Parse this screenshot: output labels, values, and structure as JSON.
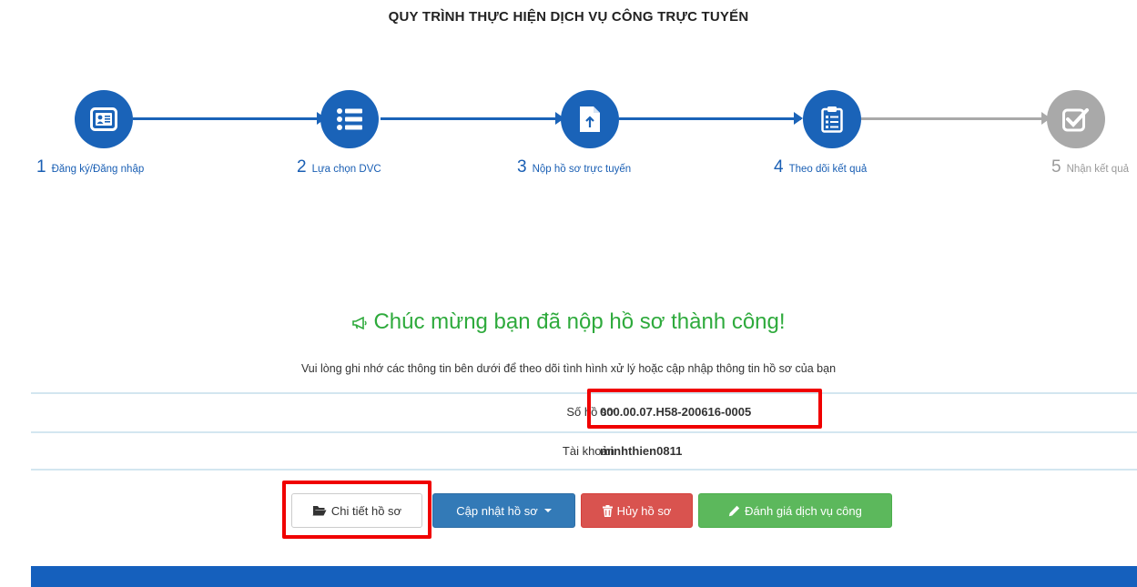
{
  "page": {
    "title": "QUY TRÌNH THỰC HIỆN DỊCH VỤ CÔNG TRỰC TUYẾN"
  },
  "steps": [
    {
      "number": "1",
      "label": "Đăng ký/Đăng nhập",
      "icon": "id-card-icon",
      "state": "active"
    },
    {
      "number": "2",
      "label": "Lựa chọn DVC",
      "icon": "list-icon",
      "state": "active"
    },
    {
      "number": "3",
      "label": "Nộp hồ sơ trực tuyến",
      "icon": "document-upload-icon",
      "state": "active"
    },
    {
      "number": "4",
      "label": "Theo dõi kết quả",
      "icon": "clipboard-icon",
      "state": "active"
    },
    {
      "number": "5",
      "label": "Nhận kết quả",
      "icon": "check-square-icon",
      "state": "inactive"
    }
  ],
  "colors": {
    "active": "#1a63b8",
    "inactive": "#a9a9a9",
    "success_text": "#2eaa3c",
    "highlight": "#f00000",
    "footer": "#1560bd"
  },
  "success": {
    "icon": "megaphone-icon",
    "title": "Chúc mừng bạn đã nộp hồ sơ thành công!",
    "subtitle": "Vui lòng ghi nhớ các thông tin bên dưới để theo dõi tình hình xử lý hoặc cập nhập thông tin hồ sơ của bạn"
  },
  "info": {
    "record_label": "Số hồ sơ",
    "record_value": "000.00.07.H58-200616-0005",
    "account_label": "Tài khoản",
    "account_value": "minhthien0811"
  },
  "buttons": {
    "detail": {
      "label": "Chi tiết hồ sơ",
      "icon": "folder-open-icon"
    },
    "update": {
      "label": "Cập nhật hồ sơ",
      "icon": "caret-down-icon"
    },
    "cancel": {
      "label": "Hủy hồ sơ",
      "icon": "trash-icon"
    },
    "rate": {
      "label": "Đánh giá dịch vụ công",
      "icon": "pencil-icon"
    }
  }
}
